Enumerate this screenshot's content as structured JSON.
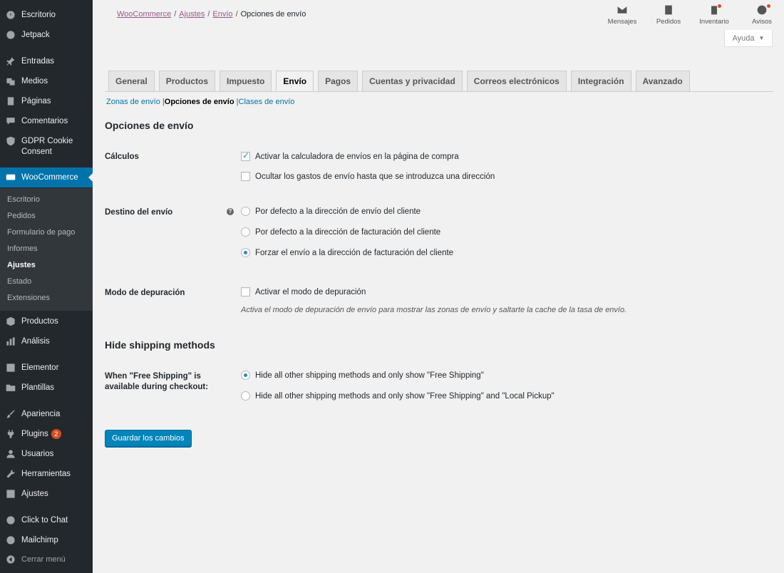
{
  "sidebar": {
    "items": [
      {
        "label": "Escritorio",
        "icon": "dashboard-icon"
      },
      {
        "label": "Jetpack",
        "icon": "jetpack-icon"
      },
      {
        "label": "Entradas",
        "icon": "pin-icon"
      },
      {
        "label": "Medios",
        "icon": "media-icon"
      },
      {
        "label": "Páginas",
        "icon": "pages-icon"
      },
      {
        "label": "Comentarios",
        "icon": "comments-icon"
      },
      {
        "label": "GDPR Cookie Consent",
        "icon": "shield-icon"
      },
      {
        "label": "WooCommerce",
        "icon": "woocommerce-icon"
      },
      {
        "label": "Productos",
        "icon": "box-icon"
      },
      {
        "label": "Análisis",
        "icon": "chart-icon"
      },
      {
        "label": "Elementor",
        "icon": "elementor-icon"
      },
      {
        "label": "Plantillas",
        "icon": "folder-icon"
      },
      {
        "label": "Apariencia",
        "icon": "brush-icon"
      },
      {
        "label": "Plugins",
        "icon": "plugin-icon",
        "badge": "2"
      },
      {
        "label": "Usuarios",
        "icon": "user-icon"
      },
      {
        "label": "Herramientas",
        "icon": "wrench-icon"
      },
      {
        "label": "Ajustes",
        "icon": "settings-icon"
      },
      {
        "label": "Click to Chat",
        "icon": "whatsapp-icon"
      },
      {
        "label": "Mailchimp",
        "icon": "mailchimp-icon"
      },
      {
        "label": "Cerrar menú",
        "icon": "collapse-icon"
      }
    ],
    "submenu": [
      "Escritorio",
      "Pedidos",
      "Formulario de pago",
      "Informes",
      "Ajustes",
      "Estado",
      "Extensiones"
    ],
    "submenu_current": "Ajustes"
  },
  "breadcrumb": {
    "items": [
      "WooCommerce",
      "Ajustes",
      "Envío"
    ],
    "separator": "/",
    "current": "Opciones de envío"
  },
  "topbar": {
    "icons": [
      {
        "label": "Mensajes",
        "icon": "envelope-icon"
      },
      {
        "label": "Pedidos",
        "icon": "orders-icon"
      },
      {
        "label": "Inventario",
        "icon": "clipboard-icon"
      },
      {
        "label": "Avisos",
        "icon": "wordpress-icon"
      }
    ],
    "help_label": "Ayuda",
    "help_arrow": "▼"
  },
  "tabs": [
    "General",
    "Productos",
    "Impuesto",
    "Envío",
    "Pagos",
    "Cuentas y privacidad",
    "Correos electrónicos",
    "Integración",
    "Avanzado"
  ],
  "active_tab": "Envío",
  "subnav": {
    "zones": "Zonas de envío",
    "options": "Opciones de envío",
    "classes": "Clases de envío",
    "separator": "|"
  },
  "section1": {
    "title": "Opciones de envío",
    "calculos": {
      "label": "Cálculos",
      "opt1": "Activar la calculadora de envíos en la página de compra",
      "opt1_checked": true,
      "opt2": "Ocultar los gastos de envío hasta que se introduzca una dirección",
      "opt2_checked": false
    },
    "destino": {
      "label": "Destino del envío",
      "help": "?",
      "opt1": "Por defecto a la dirección de envío del cliente",
      "opt2": "Por defecto a la dirección de facturación del cliente",
      "opt3": "Forzar el envío a la dirección de facturación del cliente",
      "selected": 3
    },
    "debug": {
      "label": "Modo de depuración",
      "opt1": "Activar el modo de depuración",
      "checked": false,
      "description": "Activa el modo de depuración de envío para mostrar las zonas de envío y saltarte la cache de la tasa de envío."
    }
  },
  "section2": {
    "title": "Hide shipping methods",
    "label": "When \"Free Shipping\" is available during checkout:",
    "opt1": "Hide all other shipping methods and only show \"Free Shipping\"",
    "opt2": "Hide all other shipping methods and only show \"Free Shipping\" and \"Local Pickup\"",
    "selected": 1
  },
  "save_label": "Guardar los cambios",
  "colors": {
    "sidebar_bg": "#23282d",
    "active_menu": "#0073aa",
    "link": "#0073aa",
    "breadcrumb_link": "#96588a",
    "primary_button": "#0085ba"
  }
}
